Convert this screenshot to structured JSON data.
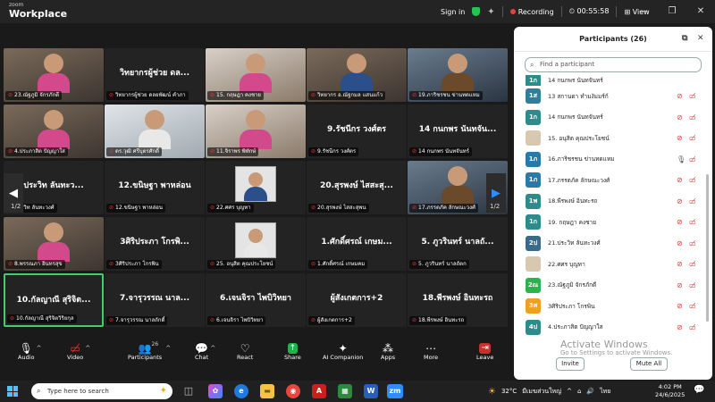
{
  "app": {
    "brand_small": "zoom",
    "brand_big": "Workplace"
  },
  "titlebar": {
    "sign_in": "Sign in",
    "recording": "Recording",
    "timer": "00:55:58",
    "view": "View"
  },
  "stage": {
    "page_left": "1/2",
    "page_right": "1/2"
  },
  "tiles": [
    {
      "big": "",
      "label": "23.ณัฐภูมิ จักรภักดี",
      "kind": "video"
    },
    {
      "big": "วิทยากรผู้ช่วย ดล...",
      "label": "วิทยากรผู้ช่วย ดลยพัฒน์ คำภา",
      "kind": "name"
    },
    {
      "big": "",
      "label": "15. กฤษฎา คงชาย",
      "kind": "video"
    },
    {
      "big": "",
      "label": "วิทยากร อ.ณัฐกมล แสนแก้ว",
      "kind": "video"
    },
    {
      "big": "",
      "label": "19.ภาริชรชน ข่านทดแหม",
      "kind": "video"
    },
    {
      "big": "",
      "label": "4.ประภาสิต ปัญญาใส",
      "kind": "video"
    },
    {
      "big": "",
      "label": "ดร.วุฒิ ศรีบุตรศักดิ์",
      "kind": "video"
    },
    {
      "big": "",
      "label": "11.จิราพร พิทักษ์",
      "kind": "video"
    },
    {
      "big": "9.รัชนีกร วงศ์ตร",
      "label": "9.รัชนีกร วงศ์ตร",
      "kind": "name"
    },
    {
      "big": "14 กนกพร นันทจัน...",
      "label": "14 กนกพร นันทจันทร์",
      "kind": "name"
    },
    {
      "big": "ประวิท ลันทะว...",
      "label": "ประวิท ลันทะวงศ์",
      "kind": "name"
    },
    {
      "big": "12.ขนิษฐา พาหล่อน",
      "label": "12.ขนิษฐา พาหล่อน",
      "kind": "name"
    },
    {
      "big": "",
      "label": "22.ศศร บุญทา",
      "kind": "photo"
    },
    {
      "big": "20.สุรพงษ์ ไสสะสุ...",
      "label": "20.สุรพงษ์ ไสสะสุพน",
      "kind": "name"
    },
    {
      "big": "",
      "label": "17.ภรรตภัค ลักษณะวงศ์",
      "kind": "video"
    },
    {
      "big": "",
      "label": "8.พรรณภา อินทรสุข",
      "kind": "video"
    },
    {
      "big": "3ศิริประภา โกรพิ...",
      "label": "3ศิริประภา โกรพิน",
      "kind": "name"
    },
    {
      "big": "",
      "label": "25. อนุสิต คุณประโยชน์",
      "kind": "photo"
    },
    {
      "big": "1.ศักดิ์ศรณ์ เกษม...",
      "label": "1.ศักดิ์ศรณ์ เกษมคม",
      "kind": "name"
    },
    {
      "big": "5. ภูวรินทร์ นาลถั...",
      "label": "5. ภูวรินทร์ นาลถัตก",
      "kind": "name"
    },
    {
      "big": "10.กัลญาณี สุริจิต...",
      "label": "10.กัลญาณี สุริจิตวิริยกุล",
      "kind": "name"
    },
    {
      "big": "7.จารุวรรณ นาล...",
      "label": "7.จารุวรรณ นาลถักดิ์",
      "kind": "name"
    },
    {
      "big": "6.เจนจิรา ไพบิวิทยา",
      "label": "6.เจนจิรา ไพบิวิทยา",
      "kind": "name"
    },
    {
      "big": "ผู้สังเกตการ+2",
      "label": "ผู้สังเกตการ+2",
      "kind": "name"
    },
    {
      "big": "18.พีรพงษ์ อินทะรถ",
      "label": "18.พีรพงษ์ อินทะรถ",
      "kind": "name"
    }
  ],
  "toolbar": {
    "audio": "Audio",
    "video": "Video",
    "participants": "Participants",
    "participants_count": "26",
    "chat": "Chat",
    "share": "Share",
    "react": "React",
    "ai_companion": "AI Companion",
    "apps": "Apps",
    "more": "More",
    "leave": "Leave"
  },
  "panel": {
    "title": "Participants (26)",
    "search_placeholder": "Find a participant",
    "invite": "Invite",
    "mute_all": "Mute All",
    "watermark_title": "Activate Windows",
    "watermark_sub": "Go to Settings to activate Windows.",
    "participants": [
      {
        "initials": "1ก",
        "color": "#2e8b8b",
        "name": "14 กนกพร นันทจันทร์",
        "partial": true
      },
      {
        "initials": "1ส",
        "color": "#2f7f9b",
        "name": "13 สกานดา ทำมงัมมร์ก์",
        "mic": "muted",
        "cam": "off"
      },
      {
        "initials": "1ก",
        "color": "#2e8b8b",
        "name": "14 กนกพร นันทจันทร์",
        "mic": "muted",
        "cam": "off"
      },
      {
        "initials": "",
        "color": "#d8c8b0",
        "name": "15. อนุสิต คุณประโยชน์",
        "mic": "muted",
        "cam": "off"
      },
      {
        "initials": "1ภ",
        "color": "#2a7aa8",
        "name": "16.ภาริชรชน ข่านทดแหม",
        "mic": "on",
        "cam": "off"
      },
      {
        "initials": "1ภ",
        "color": "#2a7aa8",
        "name": "17.ภรรตภัค ลักษณะวงศ์",
        "mic": "muted",
        "cam": "off"
      },
      {
        "initials": "1พ",
        "color": "#2e8b8b",
        "name": "18.พีรพงษ์ อินทะรถ",
        "mic": "muted",
        "cam": "off"
      },
      {
        "initials": "1ก",
        "color": "#2e8b8b",
        "name": "19. กฤษฎา คงชาย",
        "mic": "muted",
        "cam": "off"
      },
      {
        "initials": "2ป",
        "color": "#3a6a8a",
        "name": "21.ประวิท ลันทะวงศ์",
        "mic": "muted",
        "cam": "off"
      },
      {
        "initials": "",
        "color": "#d8c8b0",
        "name": "22.ศศร บุญทา",
        "mic": "muted",
        "cam": "off"
      },
      {
        "initials": "2ณ",
        "color": "#2bb24c",
        "name": "23.ณัฐภูมิ จักรภักดี",
        "mic": "muted",
        "cam": "off"
      },
      {
        "initials": "3ศ",
        "color": "#f0a020",
        "name": "3ศิริประภา โกรพิน",
        "mic": "muted",
        "cam": "off"
      },
      {
        "initials": "4ป",
        "color": "#2e8b8b",
        "name": "4.ประภาสิต ปัญญาใส",
        "mic": "muted",
        "cam": "off"
      }
    ]
  },
  "taskbar": {
    "search": "Type here to search",
    "temp": "32°C",
    "weather": "มีเมฆส่วนใหญ่",
    "lang": "ไทย",
    "time": "4:02 PM",
    "date": "24/6/2025"
  },
  "colors": {
    "accent": "#2d8cff",
    "recording": "#e0443a",
    "muted": "#e23b3b",
    "active_speaker": "#3fd06a",
    "share": "#23b14d",
    "leave": "#c8302c"
  }
}
